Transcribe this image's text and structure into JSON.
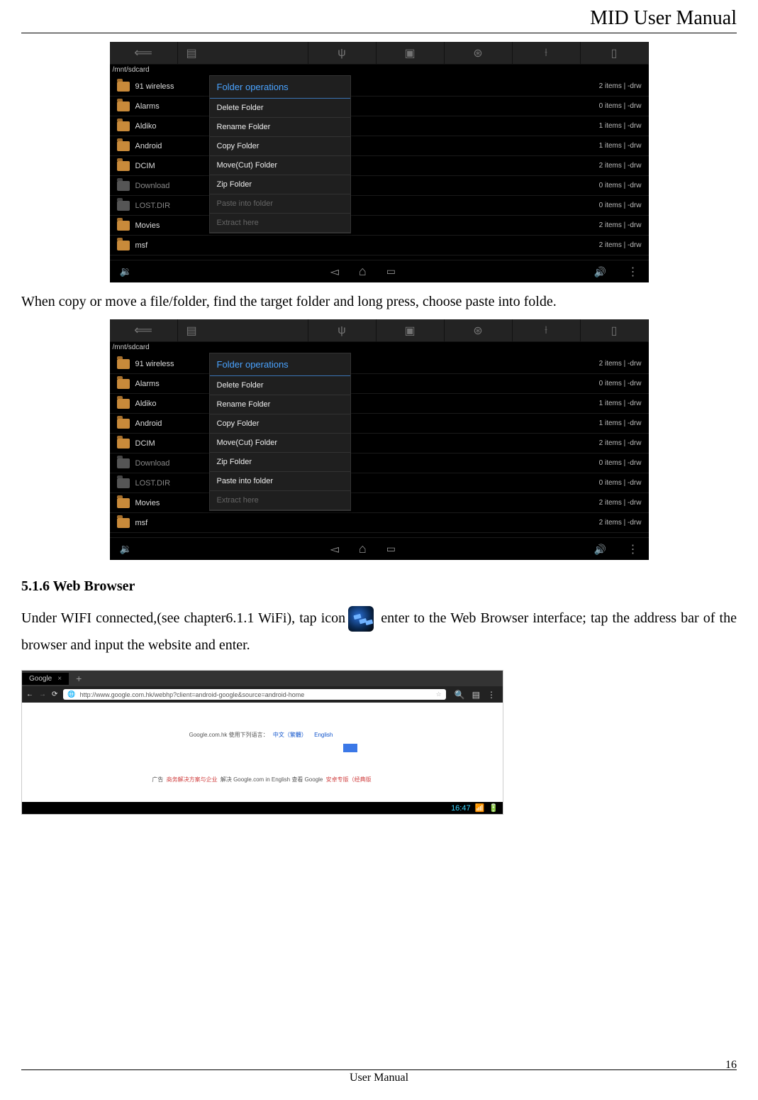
{
  "header": {
    "title": "MID User Manual"
  },
  "footer": {
    "label": "User Manual",
    "page_number": "16"
  },
  "paragraph1": "When copy or move a file/folder, find the target folder and long press, choose paste into folde.",
  "section_heading": "5.1.6 Web Browser",
  "paragraph2_a": "Under WIFI connected,(see chapter6.1.1 WiFi), tap icon",
  "paragraph2_b": " enter to the Web Browser interface; tap the address bar of the browser and input the website and enter.",
  "shot1": {
    "path": "/mnt/sdcard",
    "dialog_title": "Folder operations",
    "dialog_items": [
      {
        "label": "Delete Folder",
        "enabled": true
      },
      {
        "label": "Rename Folder",
        "enabled": true
      },
      {
        "label": "Copy Folder",
        "enabled": true
      },
      {
        "label": "Move(Cut) Folder",
        "enabled": true
      },
      {
        "label": "Zip Folder",
        "enabled": true
      },
      {
        "label": "Paste into folder",
        "enabled": false
      },
      {
        "label": "Extract here",
        "enabled": false
      }
    ],
    "rows": [
      {
        "name": "91 wireless",
        "meta": "2 items | -drw",
        "dim": false
      },
      {
        "name": "Alarms",
        "meta": "0 items | -drw",
        "dim": false
      },
      {
        "name": "Aldiko",
        "meta": "1 items | -drw",
        "dim": false
      },
      {
        "name": "Android",
        "meta": "1 items | -drw",
        "dim": false
      },
      {
        "name": "DCIM",
        "meta": "2 items | -drw",
        "dim": false
      },
      {
        "name": "Download",
        "meta": "0 items | -drw",
        "dim": true
      },
      {
        "name": "LOST.DIR",
        "meta": "0 items | -drw",
        "dim": true
      },
      {
        "name": "Movies",
        "meta": "2 items | -drw",
        "dim": false
      },
      {
        "name": "msf",
        "meta": "2 items | -drw",
        "dim": false
      }
    ]
  },
  "shot2": {
    "path": "/mnt/sdcard",
    "dialog_title": "Folder operations",
    "dialog_items": [
      {
        "label": "Delete Folder",
        "enabled": true
      },
      {
        "label": "Rename Folder",
        "enabled": true
      },
      {
        "label": "Copy Folder",
        "enabled": true
      },
      {
        "label": "Move(Cut) Folder",
        "enabled": true
      },
      {
        "label": "Zip Folder",
        "enabled": true
      },
      {
        "label": "Paste into folder",
        "enabled": true
      },
      {
        "label": "Extract here",
        "enabled": false
      }
    ],
    "rows": [
      {
        "name": "91 wireless",
        "meta": "2 items | -drw",
        "dim": false
      },
      {
        "name": "Alarms",
        "meta": "0 items | -drw",
        "dim": false
      },
      {
        "name": "Aldiko",
        "meta": "1 items | -drw",
        "dim": false
      },
      {
        "name": "Android",
        "meta": "1 items | -drw",
        "dim": false
      },
      {
        "name": "DCIM",
        "meta": "2 items | -drw",
        "dim": false
      },
      {
        "name": "Download",
        "meta": "0 items | -drw",
        "dim": true
      },
      {
        "name": "LOST.DIR",
        "meta": "0 items | -drw",
        "dim": true
      },
      {
        "name": "Movies",
        "meta": "2 items | -drw",
        "dim": false
      },
      {
        "name": "msf",
        "meta": "2 items | -drw",
        "dim": false
      }
    ]
  },
  "browser": {
    "tab_label": "Google",
    "url": "http://www.google.com.hk/webhp?client=android-google&source=android-home",
    "lang_prefix": "Google.com.hk 使用下列语言：",
    "lang_links": [
      "中文（繁體）",
      "English"
    ],
    "footer_widgets": [
      "广告",
      "商务解决方案与企业",
      "解决",
      "Google.com in English",
      "查看 Google",
      "安卓专版（经典版"
    ],
    "clock": "16:47"
  }
}
